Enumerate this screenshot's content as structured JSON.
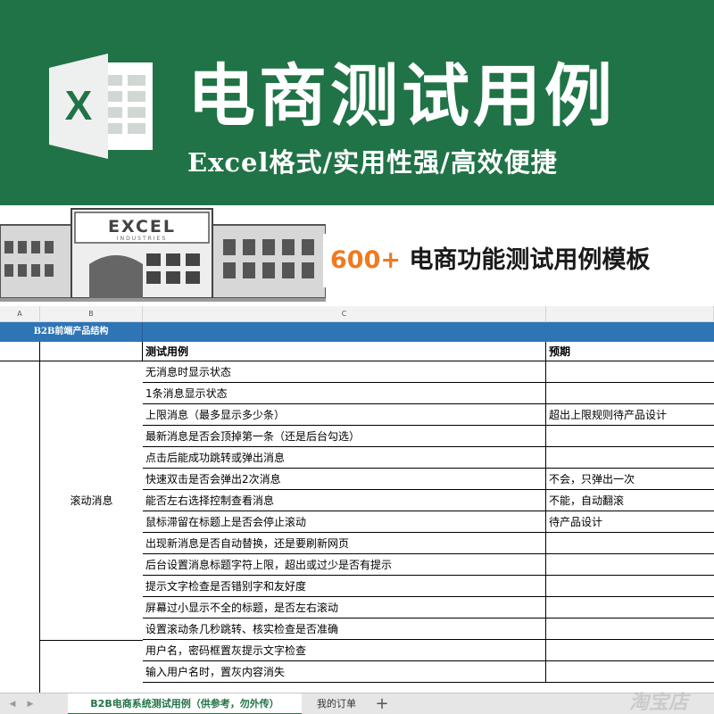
{
  "banner": {
    "title": "电商测试用例",
    "subtitle": "Excel格式/实用性强/高效便捷",
    "logo_letter": "X"
  },
  "factory": {
    "sign_main": "EXCEL",
    "sign_sub": "INDUSTRIES"
  },
  "promo": {
    "count": "600+",
    "label": "电商功能测试用例模板"
  },
  "sheet": {
    "columns": [
      "A",
      "B",
      "C"
    ],
    "section_title": "B2B前端产品结构",
    "headers": {
      "case": "测试用例",
      "expected": "预期"
    },
    "groups": [
      {
        "name": "滚动消息"
      },
      {
        "name": ""
      }
    ],
    "rows": [
      {
        "case": "无消息时显示状态",
        "expected": ""
      },
      {
        "case": "1条消息显示状态",
        "expected": ""
      },
      {
        "case": "上限消息（最多显示多少条）",
        "expected": "超出上限规则待产品设计"
      },
      {
        "case": "最新消息是否会顶掉第一条（还是后台勾选）",
        "expected": ""
      },
      {
        "case": "点击后能成功跳转或弹出消息",
        "expected": ""
      },
      {
        "case": "快速双击是否会弹出2次消息",
        "expected": "不会，只弹出一次"
      },
      {
        "case": "能否左右选择控制查看消息",
        "expected": "不能，自动翻滚"
      },
      {
        "case": "鼠标滞留在标题上是否会停止滚动",
        "expected": "待产品设计"
      },
      {
        "case": "出现新消息是否自动替换，还是要刷新网页",
        "expected": ""
      },
      {
        "case": "后台设置消息标题字符上限，超出或过少是否有提示",
        "expected": ""
      },
      {
        "case": "提示文字检查是否错别字和友好度",
        "expected": ""
      },
      {
        "case": "屏幕过小显示不全的标题，是否左右滚动",
        "expected": ""
      },
      {
        "case": "设置滚动条几秒跳转、核实检查是否准确",
        "expected": ""
      },
      {
        "case": "用户名，密码框置灰提示文字检查",
        "expected": ""
      },
      {
        "case": "输入用户名时，置灰内容消失",
        "expected": ""
      }
    ]
  },
  "tabs": {
    "active": "B2B电商系统测试用例（供参考，勿外传）",
    "second": "我的订单",
    "add": "+",
    "prev_arrow": "◀",
    "next_arrow": "▶"
  },
  "watermark": "淘宝店",
  "colors": {
    "excel_green": "#207346",
    "header_blue": "#2e75b6",
    "accent_orange": "#ef7a20"
  }
}
